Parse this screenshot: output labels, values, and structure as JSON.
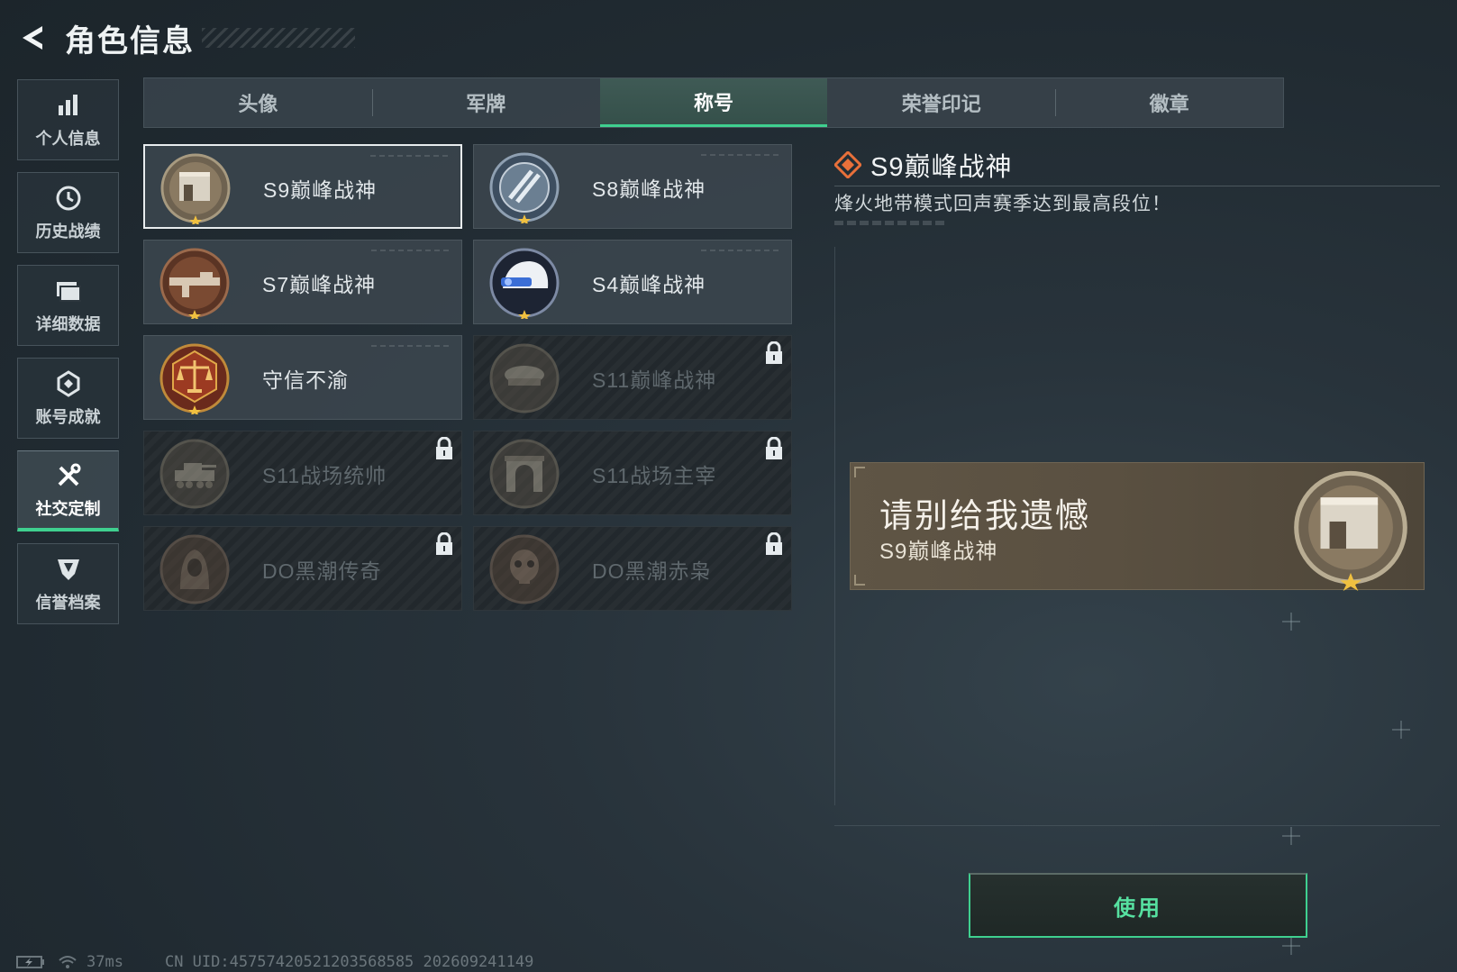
{
  "header": {
    "title": "角色信息"
  },
  "sidebar": {
    "items": [
      {
        "label": "个人信息",
        "icon": "bar-chart-icon"
      },
      {
        "label": "历史战绩",
        "icon": "clock-icon"
      },
      {
        "label": "详细数据",
        "icon": "folder-icon"
      },
      {
        "label": "账号成就",
        "icon": "achievement-icon"
      },
      {
        "label": "社交定制",
        "icon": "tools-icon",
        "active": true
      },
      {
        "label": "信誉档案",
        "icon": "shield-icon"
      }
    ]
  },
  "tabs": [
    {
      "label": "头像"
    },
    {
      "label": "军牌"
    },
    {
      "label": "称号",
      "active": true
    },
    {
      "label": "荣誉印记"
    },
    {
      "label": "徽章"
    }
  ],
  "titles": [
    {
      "name": "S9巅峰战神",
      "locked": false,
      "selected": true
    },
    {
      "name": "S8巅峰战神",
      "locked": false
    },
    {
      "name": "S7巅峰战神",
      "locked": false
    },
    {
      "name": "S4巅峰战神",
      "locked": false
    },
    {
      "name": "守信不渝",
      "locked": false
    },
    {
      "name": "S11巅峰战神",
      "locked": true
    },
    {
      "name": "S11战场统帅",
      "locked": true
    },
    {
      "name": "S11战场主宰",
      "locked": true
    },
    {
      "name": "DO黑潮传奇",
      "locked": true
    },
    {
      "name": "DO黑潮赤枭",
      "locked": true
    }
  ],
  "detail": {
    "title": "S9巅峰战神",
    "description": "烽火地带模式回声赛季达到最高段位！",
    "preview_name": "请别给我遗憾",
    "preview_title": "S9巅峰战神"
  },
  "actions": {
    "use_label": "使用"
  },
  "footer": {
    "ping": "37ms",
    "uid": "CN UID:457574205212035685​85 202609241149"
  },
  "colors": {
    "accent": "#3fd08f",
    "diamond": "#e8703a"
  }
}
